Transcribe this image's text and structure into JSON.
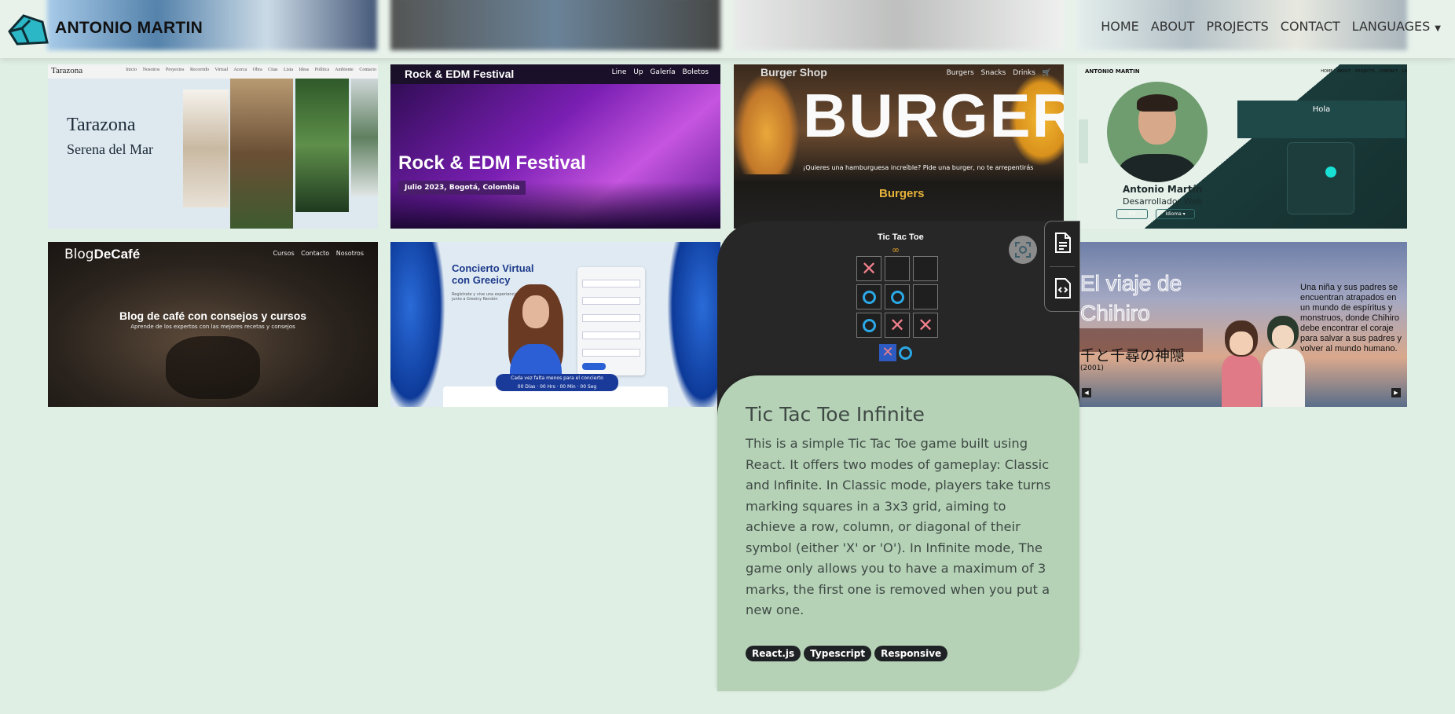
{
  "header": {
    "brand": "ANTONIO MARTIN",
    "nav": [
      {
        "label": "HOME"
      },
      {
        "label": "ABOUT"
      },
      {
        "label": "PROJECTS"
      },
      {
        "label": "CONTACT"
      },
      {
        "label": "LANGUAGES"
      }
    ]
  },
  "projects": {
    "tarazona": {
      "nav_logo": "Tarazona",
      "nav_links": "Inicio Nosotros Proyectos Recorrido Virtual Acerca Obra Citas Lista Ideas Política Ambiente Contacto",
      "title": "Tarazona",
      "subtitle": "Serena del Mar"
    },
    "festival": {
      "brand": "Rock & EDM Festival",
      "links": "Line Up  Galería  Boletos",
      "title": "Rock & EDM Festival",
      "date": "Julio 2023, Bogotá, Colombia"
    },
    "burger": {
      "shop": "Burger Shop",
      "links": "Burgers  Snacks  Drinks  🛒",
      "big": "BURGER",
      "slogan": "¡Quieres una hamburguesa increíble? Pide una burger, no te arrepentirás",
      "section": "Burgers"
    },
    "portfolio": {
      "brand": "ANTONIO MARTIN",
      "links": "HOME ABOUT PROJECTS CONTACT LA",
      "hola": "Hola",
      "name": "Antonio Martín",
      "role": "Desarrollador Web",
      "cv": "CV",
      "idioma": "Idioma ▾"
    },
    "blog": {
      "logo_plain": "Blog",
      "logo_bold": "DeCafé",
      "links": "Cursos  Contacto  Nosotros",
      "title": "Blog de café con consejos y cursos",
      "subtitle": "Aprende de los expertos con las mejores recetas y consejos"
    },
    "concierto": {
      "title": "Concierto Virtual con Greeicy",
      "intro": "Regístrate y vive una experiencia única junto a Greeicy Rendón",
      "banner": "Cada vez falta menos para el concierto",
      "countdown": "00 Días · 00 Hrs · 00 Min · 00 Seg"
    },
    "chihiro": {
      "title": "El viaje de Chihiro",
      "japanese": "千と千尋の神隠",
      "year": "(2001)",
      "description": "Una niña y sus padres se encuentran atrapados en un mundo de espíritus y monstruos, donde Chihiro debe encontrar el coraje para salvar a sus padres y volver al mundo humano."
    }
  },
  "detail": {
    "game_title": "Tic Tac Toe",
    "infinity": "∞",
    "board": [
      "X",
      "",
      "",
      "O",
      "O",
      "",
      "O",
      "X",
      "X"
    ],
    "title": "Tic Tac Toe Infinite",
    "description": "This is a simple Tic Tac Toe game built using React. It offers two modes of gameplay: Classic and Infinite. In Classic mode, players take turns marking squares in a 3x3 grid, aiming to achieve a row, column, or diagonal of their symbol (either 'X' or 'O'). In Infinite mode, The game only allows you to have a maximum of 3 marks, the first one is removed when you put a new one.",
    "tags": [
      "React.js",
      "Typescript",
      "Responsive"
    ]
  },
  "icons": {
    "brand": "logo-icon",
    "fullscreen": "fullscreen-icon",
    "document": "document-icon",
    "code": "code-icon"
  }
}
